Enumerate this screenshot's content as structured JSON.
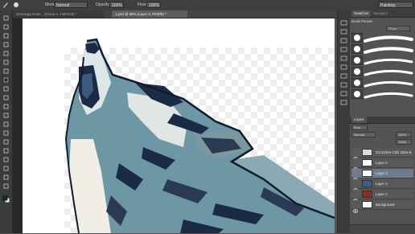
{
  "options_bar": {
    "mode_label": "Mode:",
    "mode_value": "Normal",
    "opacity_label": "Opacity:",
    "opacity_value": "100%",
    "flow_label": "Flow:",
    "flow_value": "100%",
    "workspace_value": "Painting"
  },
  "tabs": [
    {
      "label": "Descarga Howl... (Group 2, CMYK/8) *",
      "active": false
    },
    {
      "label": "1.psd @ 58% (Layer 4, RGB/8) *",
      "active": true
    }
  ],
  "panels": {
    "brush_tabs": [
      "Swatches",
      "Navigator"
    ],
    "brush_presets_title": "Brush Presets",
    "brush_size": "70 px",
    "layers_title": "Layers",
    "kind_label": "Kind",
    "blend_mode": "Normal",
    "opacity_value": "100%",
    "fill_value": "100%",
    "layers": [
      {
        "name": "Ozr12344 Cdsl 4d2a-8...",
        "selected": false,
        "thumb": "checker"
      },
      {
        "name": "Layer 5",
        "selected": false,
        "thumb": "white"
      },
      {
        "name": "Layer 4",
        "selected": true,
        "thumb": "white"
      },
      {
        "name": "Layer 3",
        "selected": false,
        "thumb": "blue"
      },
      {
        "name": "Layer 2",
        "selected": false,
        "thumb": "red"
      },
      {
        "name": "Background",
        "selected": false,
        "thumb": "white"
      }
    ]
  },
  "colors": {
    "wolf_teal": "#6e97a6",
    "wolf_dark": "#1b2b45",
    "wolf_light": "#dde7ea",
    "selection_blue": "#6f7b8c"
  },
  "icons": [
    "move-icon",
    "marquee-icon",
    "lasso-icon",
    "quick-select-icon",
    "crop-icon",
    "eyedropper-icon",
    "healing-icon",
    "brush-icon",
    "stamp-icon",
    "history-brush-icon",
    "eraser-icon",
    "gradient-icon",
    "blur-icon",
    "dodge-icon",
    "pen-icon",
    "type-icon",
    "path-select-icon",
    "shape-icon",
    "hand-icon",
    "zoom-icon"
  ]
}
